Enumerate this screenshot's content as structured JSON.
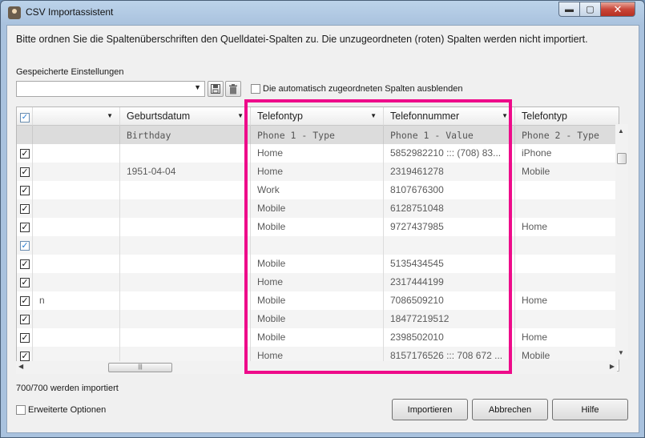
{
  "window": {
    "title": "CSV Importassistent"
  },
  "instructions": "Bitte ordnen Sie die Spaltenüberschriften den Quelldatei-Spalten zu. Die unzugeordneten (roten) Spalten werden nicht importiert.",
  "settings": {
    "label": "Gespeicherte Einstellungen",
    "value": "",
    "hide_label": "Die automatisch zugeordneten Spalten ausblenden",
    "hide_checked": false
  },
  "columns": {
    "headers": [
      "",
      "Geburtsdatum",
      "Telefontyp",
      "Telefonnummer",
      "Telefontyp"
    ],
    "source": [
      "",
      "Birthday",
      "Phone 1 - Type",
      "Phone 1 - Value",
      "Phone 2 - Type"
    ]
  },
  "rows": [
    {
      "c1": "",
      "c2": "",
      "c3": "Home",
      "c4": "5852982210 ::: (708) 83...",
      "c5": "iPhone"
    },
    {
      "c1": "",
      "c2": "1951-04-04",
      "c3": "Home",
      "c4": "2319461278",
      "c5": "Mobile"
    },
    {
      "c1": "",
      "c2": "",
      "c3": "Work",
      "c4": "8107676300",
      "c5": ""
    },
    {
      "c1": "",
      "c2": "",
      "c3": "Mobile",
      "c4": "6128751048",
      "c5": ""
    },
    {
      "c1": "",
      "c2": "",
      "c3": "Mobile",
      "c4": "9727437985",
      "c5": "Home"
    },
    {
      "c1": "",
      "c2": "",
      "c3": "",
      "c4": "",
      "c5": ""
    },
    {
      "c1": "",
      "c2": "",
      "c3": "Mobile",
      "c4": "5135434545",
      "c5": ""
    },
    {
      "c1": "",
      "c2": "",
      "c3": "Home",
      "c4": "2317444199",
      "c5": ""
    },
    {
      "c1": "n",
      "c2": "",
      "c3": "Mobile",
      "c4": "7086509210",
      "c5": "Home"
    },
    {
      "c1": "",
      "c2": "",
      "c3": "Mobile",
      "c4": "18477219512",
      "c5": ""
    },
    {
      "c1": "",
      "c2": "",
      "c3": "Mobile",
      "c4": "2398502010",
      "c5": "Home"
    },
    {
      "c1": "",
      "c2": "",
      "c3": "Home",
      "c4": "8157176526 ::: 708 672 ...",
      "c5": "Mobile"
    }
  ],
  "status": "700/700 werden importiert",
  "advanced_label": "Erweiterte Optionen",
  "buttons": {
    "import": "Importieren",
    "cancel": "Abbrechen",
    "help": "Hilfe"
  },
  "colors": {
    "highlight": "#ee0b8a",
    "header_checkbox": "#2a7fd4"
  },
  "icons": [
    "app-icon",
    "minimize-icon",
    "maximize-icon",
    "close-icon",
    "save-icon",
    "trash-icon",
    "chevron-down-icon"
  ]
}
